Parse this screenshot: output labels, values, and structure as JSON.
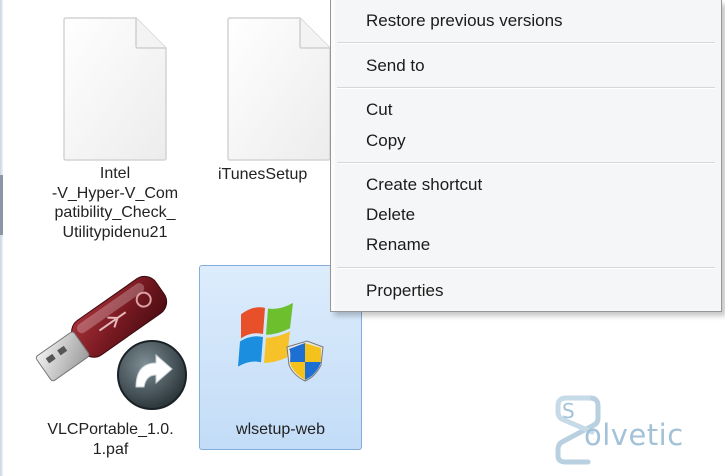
{
  "window": {
    "title": ""
  },
  "files": [
    {
      "name": "Intel\n-V_Hyper-V_Com\npatibility_Check_\nUtilitypidenu21",
      "icon": "blank-document-icon",
      "selected": false
    },
    {
      "name": "iTunesSetup",
      "icon": "blank-document-icon",
      "selected": false
    },
    {
      "name": "VLCPortable_1.0.\n1.paf",
      "icon": "usb-drive-icon",
      "selected": false
    },
    {
      "name": "wlsetup-web",
      "icon": "windows-installer-icon",
      "selected": true
    }
  ],
  "context_menu": {
    "items": [
      {
        "label": "Restore previous versions"
      },
      {
        "label": "Send to"
      },
      {
        "label": "Cut"
      },
      {
        "label": "Copy"
      },
      {
        "label": "Create shortcut"
      },
      {
        "label": "Delete"
      },
      {
        "label": "Rename"
      },
      {
        "label": "Properties"
      }
    ]
  },
  "watermark": {
    "text": "olvetic",
    "logo_letter": "S"
  },
  "colors": {
    "selection_fill": "#cfe3fa",
    "selection_border": "#84acdd",
    "menu_background": "#f5f6f7",
    "watermark": "#a3c2d8"
  }
}
